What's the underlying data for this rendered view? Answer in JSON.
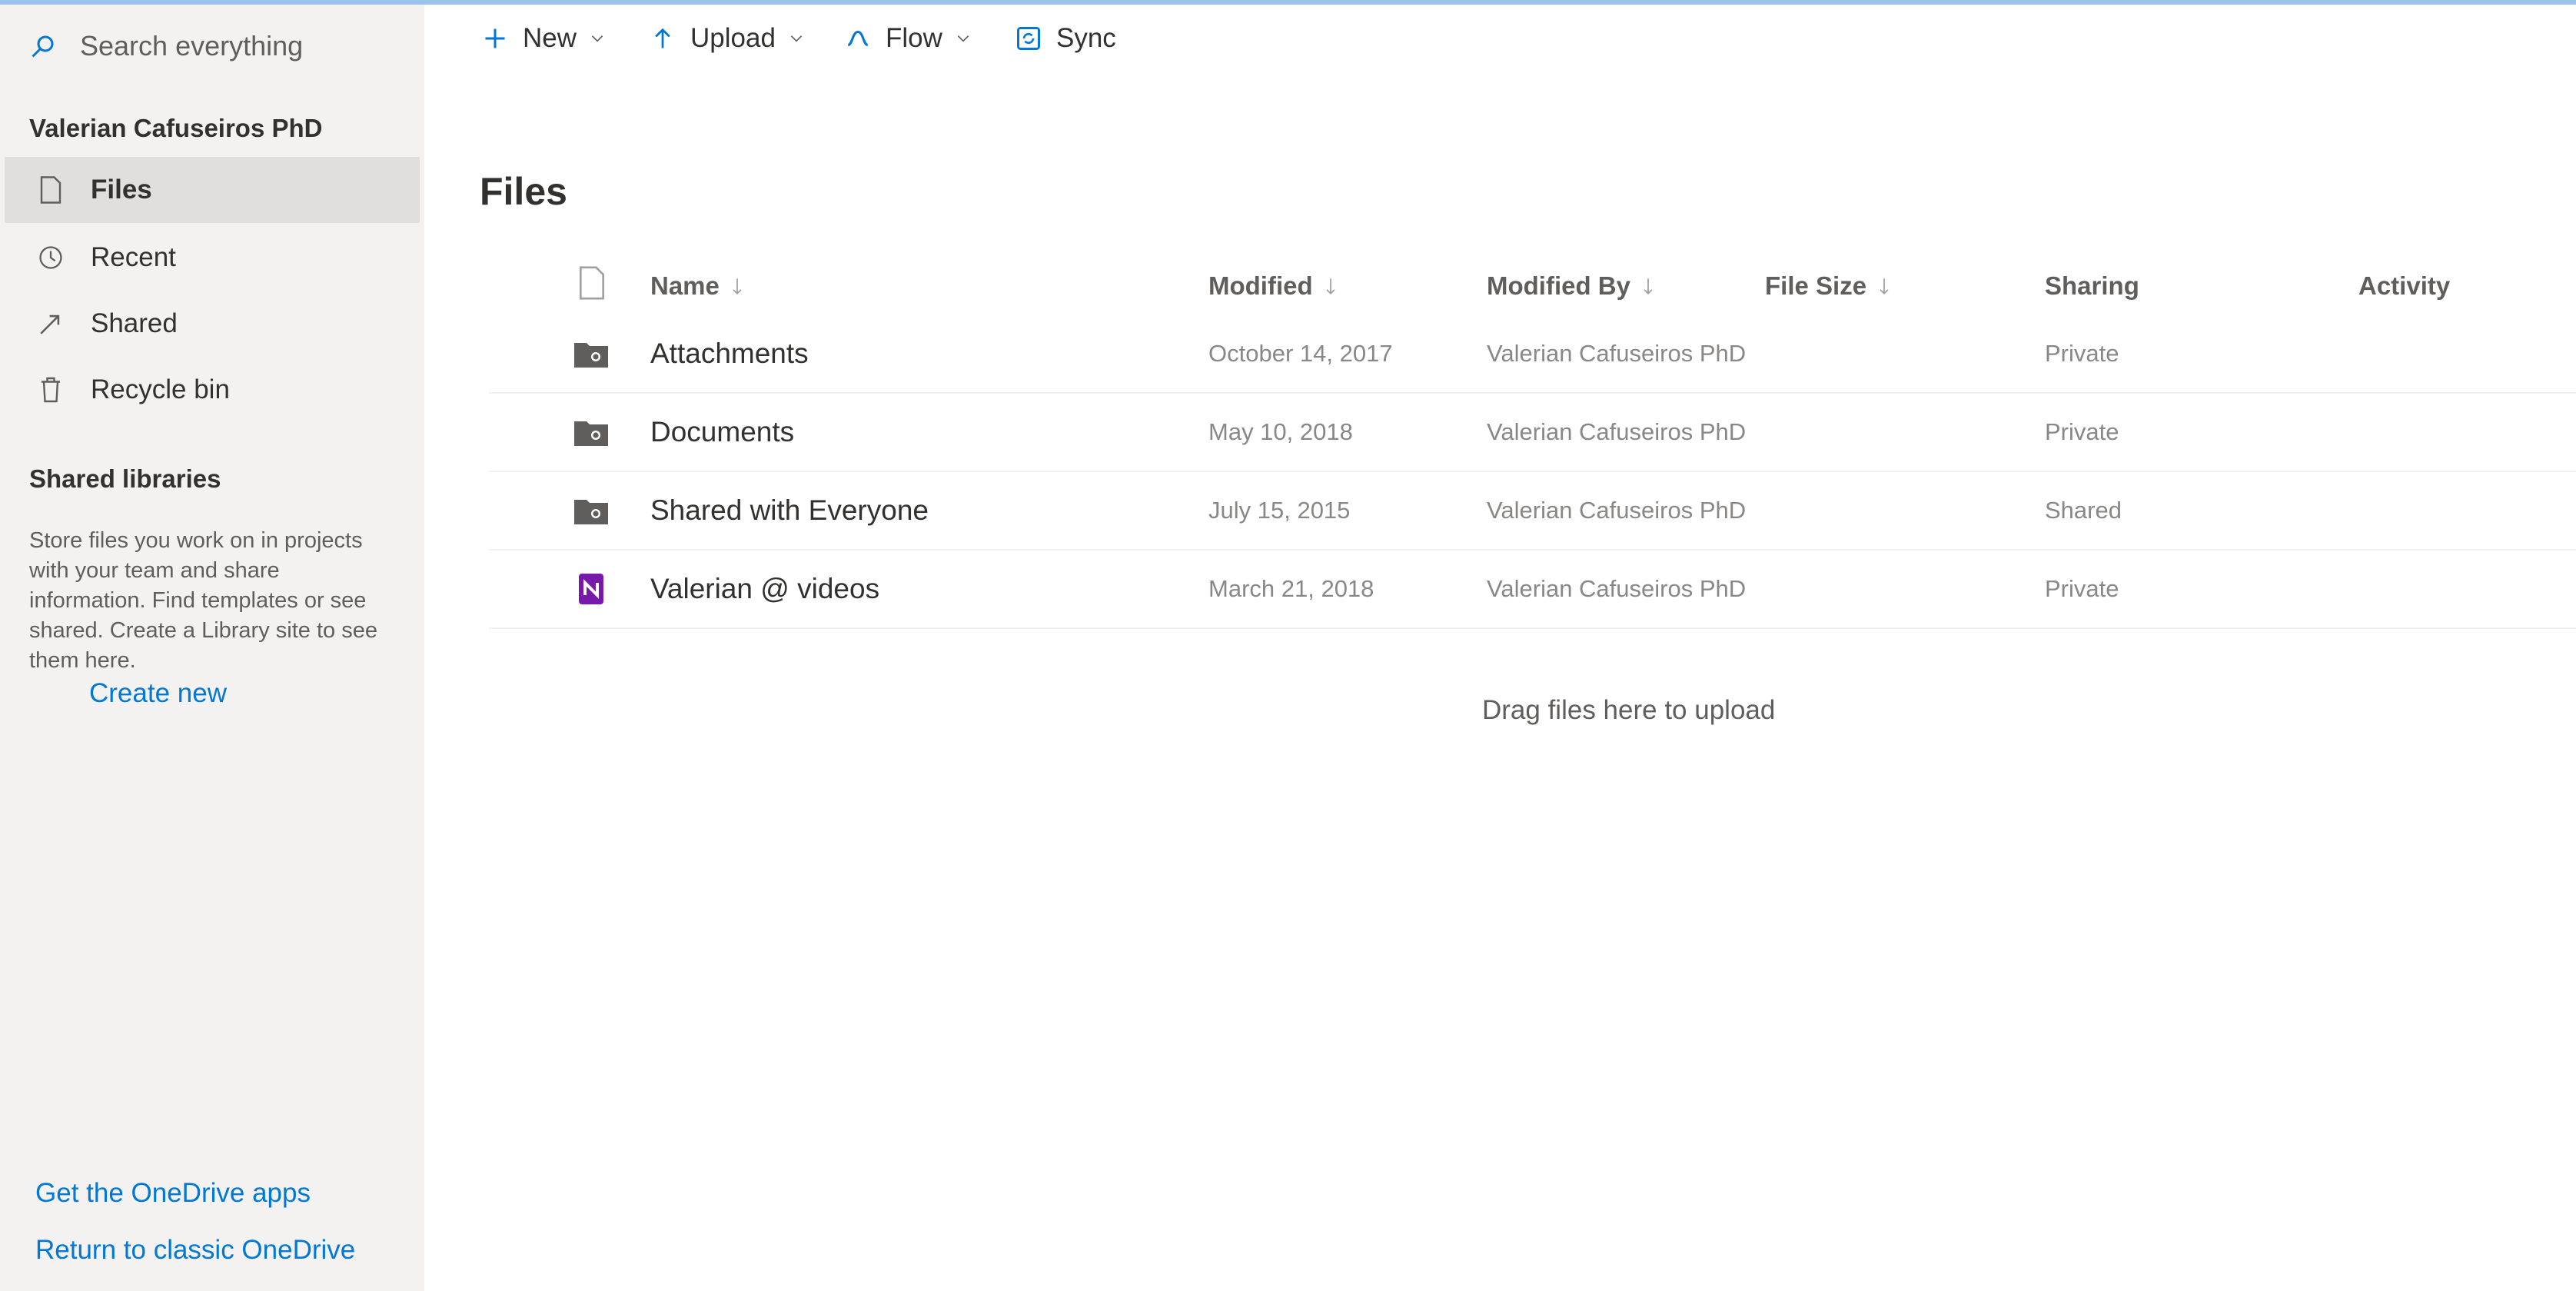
{
  "sidebar": {
    "search_placeholder": "Search everything",
    "section_title": "Valerian Cafuseiros PhD",
    "nav": [
      {
        "label": "Files"
      },
      {
        "label": "Recent"
      },
      {
        "label": "Shared"
      },
      {
        "label": "Recycle bin"
      }
    ],
    "shared_libraries_title": "Shared libraries",
    "shared_libraries_desc": "Store files you work on in projects with your team and share information. Find templates or see shared. Create a Library site to see them here.",
    "create_new": "Create new",
    "get_apps": "Get the OneDrive apps",
    "return_classic": "Return to classic OneDrive"
  },
  "commands": {
    "new": "New",
    "upload": "Upload",
    "flow": "Flow",
    "sync": "Sync"
  },
  "main": {
    "title": "Files",
    "columns": {
      "name": "Name",
      "modified": "Modified",
      "modified_by": "Modified By",
      "file_size": "File Size",
      "sharing": "Sharing",
      "activity": "Activity"
    },
    "rows": [
      {
        "name": "Attachments",
        "modified": "October 14, 2017",
        "modified_by": "Valerian Cafuseiros PhD",
        "sharing": "Private",
        "icon": "folder-icon"
      },
      {
        "name": "Documents",
        "modified": "May 10, 2018",
        "modified_by": "Valerian Cafuseiros PhD",
        "sharing": "Private",
        "icon": "folder-icon"
      },
      {
        "name": "Shared with Everyone",
        "modified": "July 15, 2015",
        "modified_by": "Valerian Cafuseiros PhD",
        "sharing": "Shared",
        "icon": "folder-icon"
      },
      {
        "name": "Valerian @ videos",
        "modified": "March 21, 2018",
        "modified_by": "Valerian Cafuseiros PhD",
        "sharing": "Private",
        "icon": "onenote-icon"
      }
    ],
    "empty_hint": "Drag files here to upload"
  },
  "colors": {
    "accent": "#0078d4",
    "sidebar_bg": "#f3f2f1",
    "onenote_purple": "#7719aa"
  }
}
